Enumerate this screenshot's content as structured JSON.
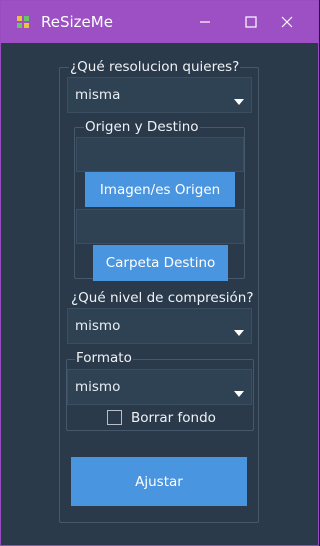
{
  "window": {
    "title": "ReSizeMe",
    "controls": [
      "minimize-icon",
      "maximize-icon",
      "close-icon"
    ]
  },
  "resolution": {
    "label": "¿Qué resolucion quieres?",
    "value": "misma"
  },
  "paths": {
    "group_label": "Origen y Destino",
    "source_value": "",
    "source_button": "Imagen/es Origen",
    "dest_value": "",
    "dest_button": "Carpeta Destino"
  },
  "compression": {
    "label": "¿Qué nivel de compresión?",
    "value": "mismo"
  },
  "format": {
    "label": "Formato",
    "value": "mismo",
    "remove_bg_label": "Borrar fondo",
    "remove_bg_checked": false
  },
  "submit_label": "Ajustar",
  "colors": {
    "titlebar": "#9d4fc4",
    "background": "#2b3a4a",
    "accent": "#4a95e0"
  }
}
